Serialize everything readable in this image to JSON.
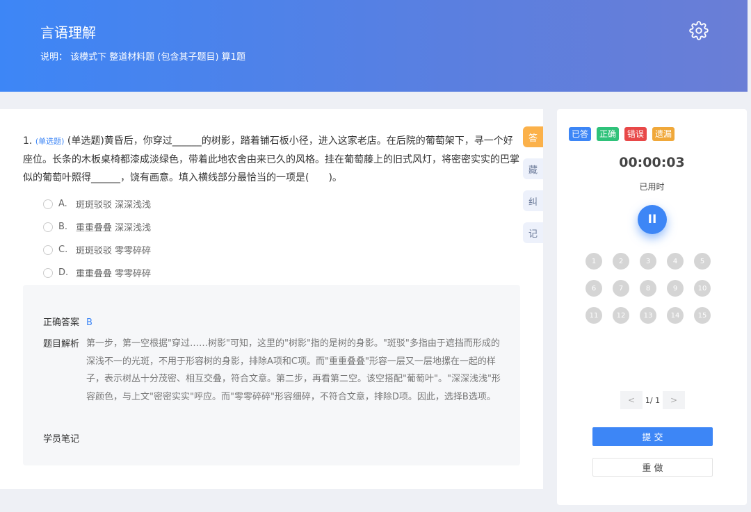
{
  "header": {
    "title": "言语理解",
    "description": "说明：  该模式下 整道材料题 (包含其子题目) 算1题",
    "settings_icon": "gear-icon"
  },
  "question": {
    "number": "1.",
    "type_tag": "(单选题)",
    "text": "(单选题)黄昏后，你穿过______的树影，踏着铺石板小径，进入这家老店。在后院的葡萄架下，寻一个好座位。长条的木板桌椅都漆成淡绿色，带着此地农舍由来已久的风格。挂在葡萄藤上的旧式风灯，将密密实实的巴掌似的葡萄叶照得______，饶有画意。填入横线部分最恰当的一项是(　　)。",
    "options": [
      {
        "letter": "A.",
        "text": "斑斑驳驳 深深浅浅"
      },
      {
        "letter": "B.",
        "text": "重重叠叠 深深浅浅"
      },
      {
        "letter": "C.",
        "text": "斑斑驳驳 零零碎碎"
      },
      {
        "letter": "D.",
        "text": "重重叠叠 零零碎碎"
      }
    ]
  },
  "side_tabs": [
    "答",
    "藏",
    "纠",
    "记"
  ],
  "analysis": {
    "answer_label": "正确答案",
    "answer_value": "B",
    "explanation_label": "题目解析",
    "explanation_text": "第一步，第一空根据\"穿过……树影\"可知，这里的\"树影\"指的是树的身影。\"斑驳\"多指由于遮挡而形成的深浅不一的光斑，不用于形容树的身影，排除A项和C项。而\"重重叠叠\"形容一层又一层地摞在一起的样子，表示树丛十分茂密、相互交叠，符合文意。第二步，再看第二空。该空搭配\"葡萄叶\"。\"深深浅浅\"形容颜色，与上文\"密密实实\"呼应。而\"零零碎碎\"形容细碎，不符合文意，排除D项。因此，选择B选项。",
    "notes_label": "学员笔记"
  },
  "status": {
    "badges": [
      {
        "label": "已答",
        "color": "#3d86f6"
      },
      {
        "label": "正确",
        "color": "#2fc27a"
      },
      {
        "label": "错误",
        "color": "#e84848"
      },
      {
        "label": "遗漏",
        "color": "#f0a83a"
      }
    ],
    "timer": "00:00:03",
    "timer_label": "已用时",
    "pause_label": "II",
    "question_numbers": [
      "1",
      "2",
      "3",
      "4",
      "5",
      "6",
      "7",
      "8",
      "9",
      "10",
      "11",
      "12",
      "13",
      "14",
      "15"
    ],
    "pager": {
      "prev": "<",
      "info": "1/ 1",
      "next": ">"
    },
    "submit_label": "提 交",
    "redo_label": "重 做"
  }
}
